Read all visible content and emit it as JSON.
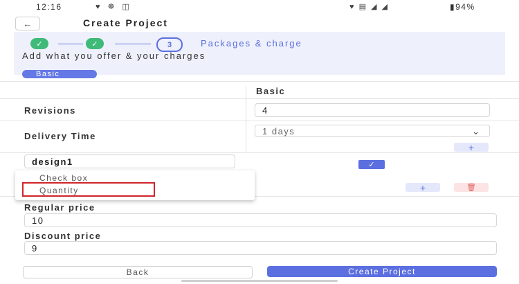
{
  "status_bar": {
    "time": "12:16",
    "left_icons": "♥ ☸ ◫",
    "right_icons": "♥ ▤ ◢ ◢",
    "battery": "▮94%"
  },
  "header": {
    "back_icon": "←",
    "title": "Create Project"
  },
  "stepper": {
    "check_glyph": "✓",
    "current_step": "3",
    "current_label": "Packages & charge",
    "subtitle": "Add what you offer & your charges"
  },
  "package_badge": "Basic",
  "table": {
    "column_header": "Basic",
    "revisions_label": "Revisions",
    "revisions_value": "4",
    "delivery_label": "Delivery Time",
    "delivery_value": "1 days",
    "chevron": "⌄",
    "plus": "+",
    "custom_feature_value": "design1",
    "check_glyph": "✓",
    "delete_icon": "🗑"
  },
  "dropdown": {
    "options": [
      "Check box",
      "Quantity"
    ],
    "highlighted": "Quantity"
  },
  "pricing": {
    "regular_label": "Regular price",
    "regular_value": "10",
    "discount_label": "Discount price",
    "discount_value": "9"
  },
  "actions": {
    "back_label": "Back",
    "create_label": "Create Project"
  },
  "colors": {
    "accent": "#5b6fe0",
    "success": "#3fba78",
    "danger": "#d0242c"
  }
}
